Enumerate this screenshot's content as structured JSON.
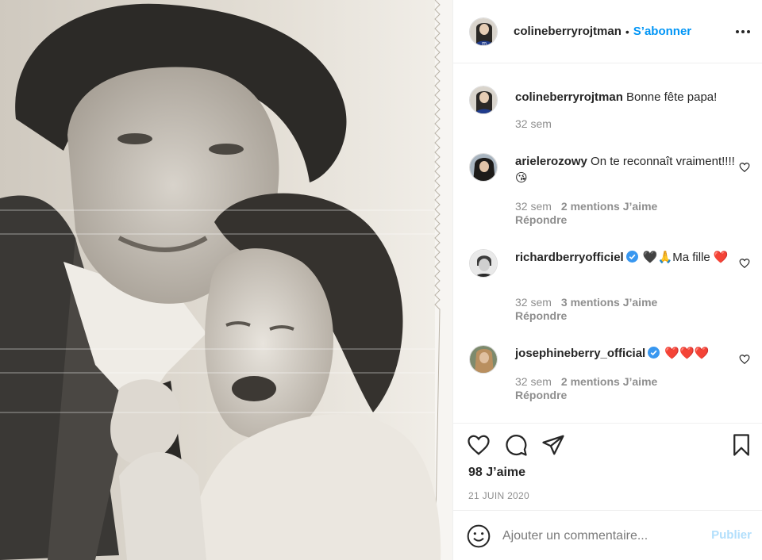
{
  "post": {
    "author": "colineberryrojtman",
    "follow_label": "S’abonner",
    "dot": "•",
    "caption_user": "colineberryrojtman",
    "caption_text": "Bonne fête papa!",
    "caption_time": "32 sem",
    "likes": "98 J’aime",
    "date": "21 JUIN 2020"
  },
  "comments": [
    {
      "user": "arielerozowy",
      "text": "On te reconnaît vraiment!!!!😘",
      "time": "32 sem",
      "likes": "2 mentions J’aime",
      "reply": "Répondre",
      "verified": false
    },
    {
      "user": "richardberryofficiel",
      "text": "🖤🙏Ma fille ❤️",
      "time": "32 sem",
      "likes": "3 mentions J’aime",
      "reply": "Répondre",
      "verified": true
    },
    {
      "user": "josephineberry_official",
      "text": "❤️❤️❤️",
      "time": "32 sem",
      "likes": "2 mentions J’aime",
      "reply": "Répondre",
      "verified": true
    }
  ],
  "composer": {
    "placeholder": "Ajouter un commentaire...",
    "publish_label": "Publier"
  },
  "icons": {
    "more": "more-options-icon",
    "like": "heart-icon",
    "comment": "comment-icon",
    "share": "paper-plane-icon",
    "save": "bookmark-icon",
    "emoji": "emoji-icon",
    "verified": "verified-badge-icon"
  },
  "colors": {
    "accent": "#0095f6",
    "publish_disabled": "#b2dffc",
    "muted": "#8e8e8e",
    "verified": "#3897f0"
  }
}
